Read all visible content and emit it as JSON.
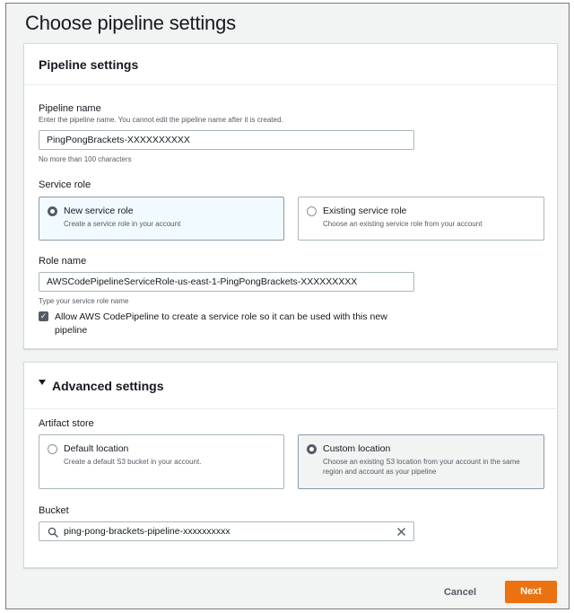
{
  "page": {
    "title": "Choose pipeline settings"
  },
  "pipeline_settings": {
    "title": "Pipeline settings",
    "pipeline_name": {
      "label": "Pipeline name",
      "description": "Enter the pipeline name. You cannot edit the pipeline name after it is created.",
      "value": "PingPongBrackets-XXXXXXXXXX",
      "constraint": "No more than 100 characters"
    },
    "service_role": {
      "label": "Service role",
      "options": [
        {
          "title": "New service role",
          "description": "Create a service role in your account",
          "selected": true
        },
        {
          "title": "Existing service role",
          "description": "Choose an existing service role from your account",
          "selected": false
        }
      ]
    },
    "role_name": {
      "label": "Role name",
      "value": "AWSCodePipelineServiceRole-us-east-1-PingPongBrackets-XXXXXXXXX",
      "hint": "Type your service role name"
    },
    "allow_checkbox": {
      "checked": true,
      "label_line1": "Allow AWS CodePipeline to create a service role so it can be used with this new",
      "label_line2": "pipeline"
    }
  },
  "advanced_settings": {
    "title": "Advanced settings",
    "expanded": true,
    "artifact_store": {
      "label": "Artifact store",
      "options": [
        {
          "title": "Default location",
          "description": "Create a default S3 bucket in your account.",
          "selected": false
        },
        {
          "title": "Custom location",
          "description": "Choose an existing S3 location from your account in the same region and account as your pipeline",
          "selected": true
        }
      ]
    },
    "bucket": {
      "label": "Bucket",
      "value": "ping-pong-brackets-pipeline-xxxxxxxxxx"
    }
  },
  "footer": {
    "cancel_label": "Cancel",
    "next_label": "Next"
  },
  "colors": {
    "primary_button": "#ec7211",
    "page_background": "#f2f3f3",
    "text": "#16191f"
  }
}
